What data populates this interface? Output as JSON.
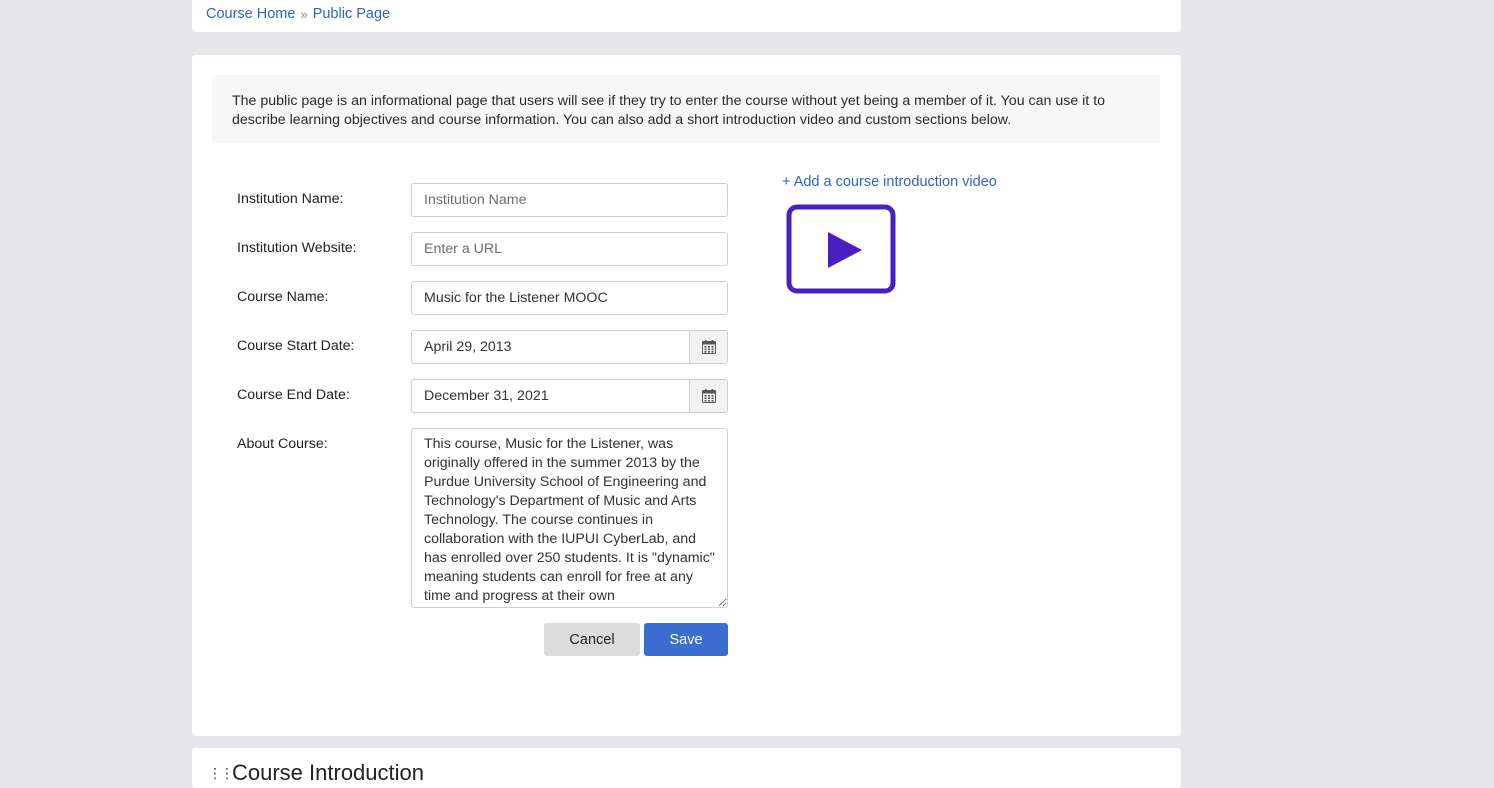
{
  "breadcrumb": {
    "home": "Course Home",
    "separator": "»",
    "current": "Public Page"
  },
  "info": {
    "text": "The public page is an informational page that users will see if they try to enter the course without yet being a member of it. You can use it to describe learning objectives and course information. You can also add a short introduction video and custom sections below."
  },
  "form": {
    "institution_name": {
      "label": "Institution Name:",
      "value": "",
      "placeholder": "Institution Name"
    },
    "institution_website": {
      "label": "Institution Website:",
      "value": "",
      "placeholder": "Enter a URL"
    },
    "course_name": {
      "label": "Course Name:",
      "value": "Music for the Listener MOOC"
    },
    "start_date": {
      "label": "Course Start Date:",
      "value": "April 29, 2013"
    },
    "end_date": {
      "label": "Course End Date:",
      "value": "December 31, 2021"
    },
    "about": {
      "label": "About Course:",
      "value": "This course, Music for the Listener, was originally offered in the summer 2013 by the Purdue University School of Engineering and Technology's Department of Music and Arts Technology. The course continues in collaboration with the IUPUI CyberLab, and has enrolled over 250 students. It is \"dynamic\" meaning students can enroll for free at any time and progress at their own"
    },
    "cancel_label": "Cancel",
    "save_label": "Save"
  },
  "video": {
    "add_label": "+ Add a course introduction video",
    "icon": "play-video-icon",
    "icon_color": "#4a1fc0"
  },
  "next_section": {
    "title": "Course Introduction"
  },
  "colors": {
    "link": "#2f63c7",
    "save_button": "#3a6fd1",
    "page_background": "#e6e6ea"
  }
}
